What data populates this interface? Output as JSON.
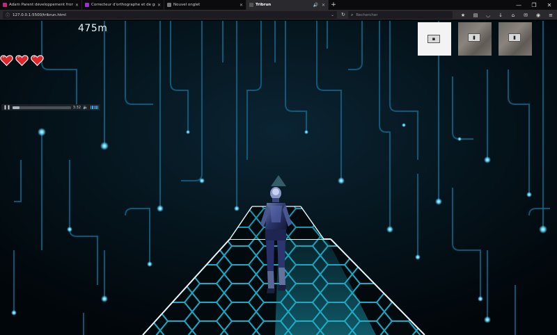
{
  "browser": {
    "tabs": [
      {
        "title": "Adam Parent développement fronte...",
        "active": false,
        "favicon_color": "#c7257a"
      },
      {
        "title": "Correcteur d'orthographe et de gra...",
        "active": false,
        "favicon_color": "#9a2fd4"
      },
      {
        "title": "Nouvel onglet",
        "active": false,
        "favicon_color": "#777777"
      },
      {
        "title": "Tribrun",
        "active": true,
        "favicon_color": "#555555"
      }
    ],
    "new_tab_label": "+",
    "url": "127.0.0.1:5500/tribrun.html",
    "search_placeholder": "Rechercher",
    "window_controls": [
      "—",
      "❐",
      "✕"
    ]
  },
  "game": {
    "distance": "475m",
    "lives": 3,
    "audio_player": {
      "time": "3:32",
      "progress": 0.12
    },
    "thumbnails": [
      {
        "style": "light"
      },
      {
        "style": "dark"
      },
      {
        "style": "dark"
      }
    ],
    "colors": {
      "background": "#02080d",
      "circuit": "#0d6f96",
      "node_glow": "#5fd3ff",
      "grid_edge": "#19c9e8",
      "heart": "#e0262d"
    }
  }
}
